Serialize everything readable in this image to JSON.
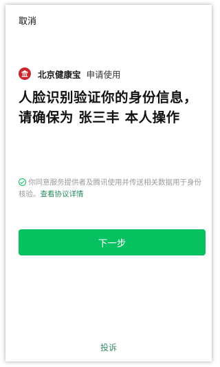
{
  "header": {
    "cancel_label": "取消"
  },
  "app": {
    "name": "北京健康宝",
    "action": "申请使用",
    "logo_icon": "temple-logo-icon",
    "logo_color": "#c8262c"
  },
  "headline": "人脸识别验证你的身份信息，请确保为 张三丰 本人操作",
  "consent": {
    "check_icon": "check-circle-icon",
    "text": "你同意服务提供者及腾讯使用并传送相关数据用于身份核验。",
    "link_label": "查看协议详情"
  },
  "primary_button": {
    "label": "下一步",
    "color": "#07c160"
  },
  "footer": {
    "complain_label": "投诉"
  }
}
